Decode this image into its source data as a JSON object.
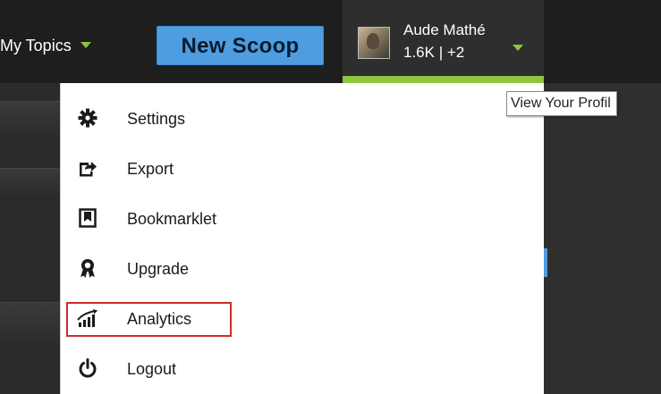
{
  "header": {
    "my_topics_label": "My Topics",
    "new_scoop_label": "New Scoop",
    "profile": {
      "name": "Aude Mathé",
      "stats": "1.6K | +2"
    }
  },
  "tooltip": {
    "text": "View Your Profil"
  },
  "menu": {
    "items": [
      {
        "label": "Settings",
        "icon": "gear-icon"
      },
      {
        "label": "Export",
        "icon": "export-icon"
      },
      {
        "label": "Bookmarklet",
        "icon": "bookmarklet-icon"
      },
      {
        "label": "Upgrade",
        "icon": "ribbon-icon"
      },
      {
        "label": "Analytics",
        "icon": "analytics-icon"
      },
      {
        "label": "Logout",
        "icon": "power-icon"
      }
    ],
    "highlighted_item": "Analytics"
  },
  "colors": {
    "accent_green": "#8dc63f",
    "button_blue": "#4d9de0",
    "highlight_red": "#d02a2a",
    "topbar_bg": "#1e1e1e"
  }
}
